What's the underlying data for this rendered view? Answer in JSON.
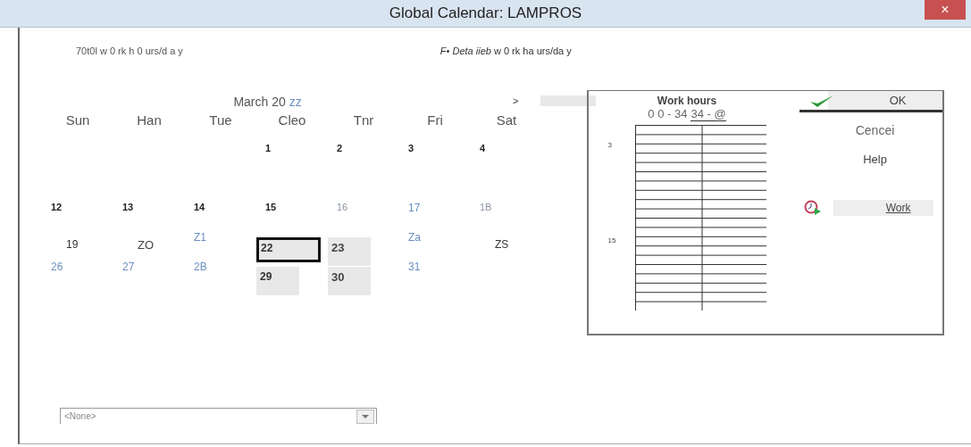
{
  "window": {
    "title": "Global Calendar: LAMPROS",
    "close": "×"
  },
  "default_note": "70t0l w 0 rk h 0 urs/d a y",
  "detail_note": "*F• Deta iieb* w 0 rk ha urs/da y",
  "calendar": {
    "month": "March 20",
    "month_suffix": "zz",
    "next": ">",
    "weekdays": [
      "Sun",
      "Han",
      "Tue",
      "Cleo",
      "Tnr",
      "Fri",
      "Sat"
    ],
    "weeks": [
      [
        {
          "kind": "blank"
        },
        {
          "kind": "blank"
        },
        {
          "kind": "blank"
        },
        {
          "day": "1",
          "kind": "bold",
          "shaded": false,
          "selected": false
        },
        {
          "day": "2",
          "kind": "bold",
          "shaded": false,
          "selected": false
        },
        {
          "day": "3",
          "kind": "bold",
          "shaded": false,
          "selected": false
        },
        {
          "day": "4",
          "kind": "bold",
          "shaded": false,
          "selected": false
        }
      ],
      [
        {
          "kind": "blank"
        },
        {
          "kind": "blank"
        },
        {
          "kind": "blank"
        },
        {
          "kind": "blank"
        },
        {
          "kind": "blank"
        },
        {
          "kind": "blank"
        },
        {
          "kind": "blank"
        }
      ],
      [
        {
          "day": "12",
          "kind": "bold",
          "shaded": false,
          "selected": false
        },
        {
          "day": "13",
          "kind": "bold",
          "shaded": false,
          "selected": false
        },
        {
          "day": "14",
          "kind": "bold",
          "shaded": false,
          "selected": false
        },
        {
          "day": "15",
          "kind": "bold",
          "shaded": false,
          "selected": false
        },
        {
          "day": "16",
          "kind": "muted",
          "shaded": false,
          "selected": false
        },
        {
          "day": "17",
          "kind": "blue",
          "shaded": false,
          "selected": false
        },
        {
          "day": "1B",
          "kind": "muted",
          "shaded": false,
          "selected": false
        }
      ],
      [
        {
          "day": "19",
          "kind": "plain",
          "shaded": false,
          "selected": false
        },
        {
          "day": "ZO",
          "kind": "plain",
          "shaded": false,
          "selected": false
        },
        {
          "day": "Z1",
          "kind": "blue",
          "shaded": false,
          "selected": false
        },
        {
          "day": "22",
          "kind": "plain",
          "shaded": true,
          "selected": true
        },
        {
          "day": "23",
          "kind": "plain",
          "shaded": true,
          "selected": false
        },
        {
          "day": "Za",
          "kind": "blue",
          "shaded": false,
          "selected": false
        },
        {
          "day": "ZS",
          "kind": "plain",
          "shaded": false,
          "selected": false
        }
      ],
      [
        {
          "day": "26",
          "kind": "blue",
          "shaded": false,
          "selected": false
        },
        {
          "day": "27",
          "kind": "blue",
          "shaded": false,
          "selected": false
        },
        {
          "day": "2B",
          "kind": "blue",
          "shaded": false,
          "selected": false
        },
        {
          "day": "29",
          "kind": "plain",
          "shaded": true,
          "selected": false
        },
        {
          "day": "30",
          "kind": "plain",
          "shaded": true,
          "selected": false
        },
        {
          "day": "31",
          "kind": "blue",
          "shaded": false,
          "selected": false
        },
        {
          "kind": "blank"
        }
      ]
    ]
  },
  "work_hours": {
    "title": "Work hours",
    "range_start": "0 0 - 34",
    "range_end": "34 - @",
    "hour_labels": [
      "3",
      "15"
    ]
  },
  "buttons": [
    {
      "label": "OK",
      "kind": "ok"
    },
    {
      "label": "Cencei",
      "kind": "plain"
    },
    {
      "label": "Help",
      "kind": "plain"
    },
    {
      "label": "Work",
      "kind": "work"
    }
  ],
  "calendar_select": {
    "value": "<None>"
  }
}
